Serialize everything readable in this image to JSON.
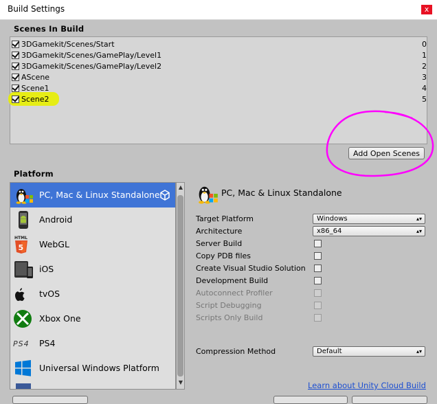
{
  "window": {
    "title": "Build Settings",
    "close_glyph": "x"
  },
  "scenes": {
    "header": "Scenes In Build",
    "items": [
      {
        "name": "3DGamekit/Scenes/Start",
        "index": "0",
        "checked": true
      },
      {
        "name": "3DGamekit/Scenes/GamePlay/Level1",
        "index": "1",
        "checked": true
      },
      {
        "name": "3DGamekit/Scenes/GamePlay/Level2",
        "index": "2",
        "checked": true
      },
      {
        "name": "AScene",
        "index": "3",
        "checked": true
      },
      {
        "name": "Scene1",
        "index": "4",
        "checked": true
      },
      {
        "name": "Scene2",
        "index": "5",
        "checked": true
      }
    ],
    "add_open_scenes_label": "Add Open Scenes"
  },
  "platform": {
    "header": "Platform",
    "items": [
      {
        "label": "PC, Mac & Linux Standalone",
        "icon": "linux-penguin-icon",
        "selected": true
      },
      {
        "label": "Android",
        "icon": "android-icon",
        "selected": false
      },
      {
        "label": "WebGL",
        "icon": "html5-icon",
        "selected": false
      },
      {
        "label": "iOS",
        "icon": "ios-device-icon",
        "selected": false
      },
      {
        "label": "tvOS",
        "icon": "apple-tv-icon",
        "selected": false
      },
      {
        "label": "Xbox One",
        "icon": "xbox-icon",
        "selected": false
      },
      {
        "label": "PS4",
        "icon": "ps4-icon",
        "selected": false
      },
      {
        "label": "Universal Windows Platform",
        "icon": "windows-icon",
        "selected": false
      }
    ]
  },
  "details": {
    "title": "PC, Mac & Linux Standalone",
    "target_platform": {
      "label": "Target Platform",
      "value": "Windows"
    },
    "architecture": {
      "label": "Architecture",
      "value": "x86_64"
    },
    "checkboxes": [
      {
        "label": "Server Build",
        "checked": false,
        "enabled": true
      },
      {
        "label": "Copy PDB files",
        "checked": false,
        "enabled": true
      },
      {
        "label": "Create Visual Studio Solution",
        "checked": false,
        "enabled": true
      },
      {
        "label": "Development Build",
        "checked": false,
        "enabled": true
      },
      {
        "label": "Autoconnect Profiler",
        "checked": false,
        "enabled": false
      },
      {
        "label": "Script Debugging",
        "checked": false,
        "enabled": false
      },
      {
        "label": "Scripts Only Build",
        "checked": false,
        "enabled": false
      }
    ],
    "compression": {
      "label": "Compression Method",
      "value": "Default"
    },
    "cloud_link": "Learn about Unity Cloud Build"
  },
  "colors": {
    "selection": "#3f74d6",
    "annotation_magenta": "#ff00ff",
    "annotation_yellow": "#e8f000"
  }
}
